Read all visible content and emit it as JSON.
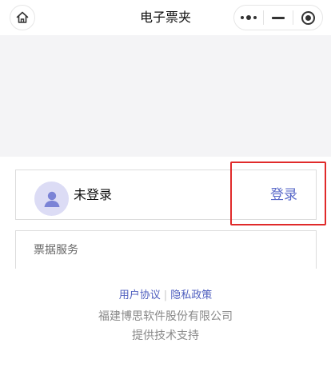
{
  "navbar": {
    "title": "电子票夹",
    "home_icon": "home-icon",
    "menu_icon": "more-dots-icon",
    "minimize_icon": "minimize-icon",
    "close_icon": "target-close-icon"
  },
  "login_card": {
    "avatar_icon": "user-avatar-icon",
    "status": "未登录",
    "login_label": "登录"
  },
  "service_card": {
    "title": "票据服务"
  },
  "footer": {
    "user_agreement": "用户协议",
    "divider": "|",
    "privacy_policy": "隐私政策",
    "company": "福建博思软件股份有限公司",
    "support": "提供技术支持"
  },
  "colors": {
    "accent": "#5a6ac9",
    "link": "#4f5fbf",
    "highlight": "#e02a2a",
    "banner_bg": "#f4f4f6",
    "avatar_bg": "#dcdcf5"
  }
}
